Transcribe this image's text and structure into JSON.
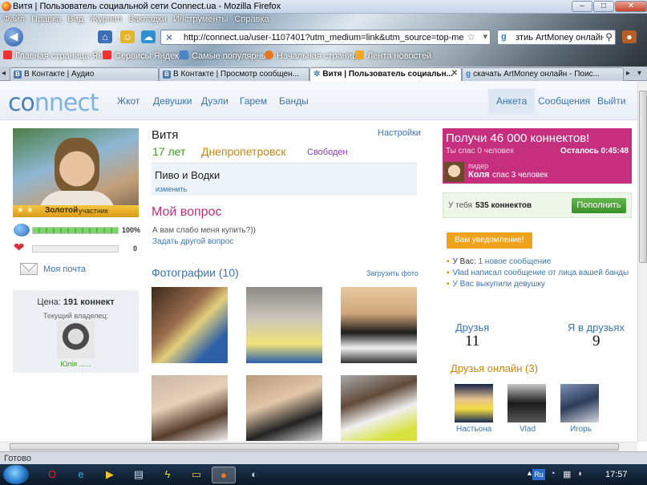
{
  "window": {
    "title": "Витя | Пользователь социальной сети Connect.ua - Mozilla Firefox",
    "minimize": "–",
    "maximize": "□",
    "close": "✕"
  },
  "menu": [
    "Файл",
    "Правка",
    "Вид",
    "Журнал",
    "Закладки",
    "Инструменты",
    "Справка"
  ],
  "nav": {
    "url": "http://connect.ua/user-1107401?utm_medium=link&utm_source=top-menu&utm_c",
    "search": "зтиь ArtMoney онлайн"
  },
  "bookmarks": [
    "Главная страница Ян...",
    "Сервисы Яндекса",
    "Самые популярные",
    "Начальная страница",
    "Лента новостей"
  ],
  "tabs": [
    {
      "label": "В Контакте | Аудио",
      "active": false
    },
    {
      "label": "В Контакте | Просмотр сообщен...",
      "active": false
    },
    {
      "label": "Витя | Пользователь социальн...",
      "active": true
    },
    {
      "label": "скачать ArtMoney онлайн - Поис...",
      "active": false
    }
  ],
  "site": {
    "logo_a": "co",
    "logo_b": "nnect",
    "nav": [
      "Жкот",
      "Девушки",
      "Дуэли",
      "Гарем",
      "Банды"
    ],
    "nav_right": [
      "Анкета",
      "Сообщения",
      "Выйти"
    ]
  },
  "profile": {
    "name": "Витя",
    "age": "17 лет",
    "city": "Днепропетровск",
    "status": "Свободен",
    "settings": "Настройки",
    "motto": "Пиво и Водки",
    "change": "изменить",
    "rank": "Золотой",
    "rank_sub": "участник",
    "stars": "★ ★",
    "stat1": "100%",
    "stat2": "0",
    "mail": "Моя почта",
    "price_label": "Цена:",
    "price_value": "191 коннект",
    "owner_label": "Текущий владелец:",
    "owner_name": "Юлія ......"
  },
  "question": {
    "title": "Мой вопрос",
    "text": "А вам слабо меня купить?))",
    "ask": "Задать другой вопрос"
  },
  "photos": {
    "title": "Фотографии (10)",
    "upload": "Загрузить фото"
  },
  "promo": {
    "title": "Получи 46 000 коннектов!",
    "saved": "Ты спас 0 человек",
    "remaining": "Осталось 0:45:48",
    "user_role": "пидер",
    "user_name": "Коля",
    "user_saved": "спас 3 человек"
  },
  "balance": {
    "prefix": "У тебя",
    "amount": "535 коннектов",
    "button": "Пополнить"
  },
  "notifications": {
    "label": "Вам уведомление!",
    "items": [
      {
        "pre": "У Вас:",
        "link": "1 новое сообщение"
      },
      {
        "pre": "",
        "link": "Vlad написал сообщение от лица вашей банды"
      },
      {
        "pre": "",
        "link": "У Вас выкупили девушку"
      }
    ]
  },
  "friends": {
    "label": "Друзья",
    "count": "11",
    "in_label": "Я в друзьях",
    "in_count": "9",
    "online_title": "Друзья онлайн (3)",
    "online": [
      "Настьона",
      "Vlad",
      "Игорь"
    ]
  },
  "statusbar": "Готово",
  "taskbar": {
    "lang": "Ru",
    "time": "17:57"
  }
}
